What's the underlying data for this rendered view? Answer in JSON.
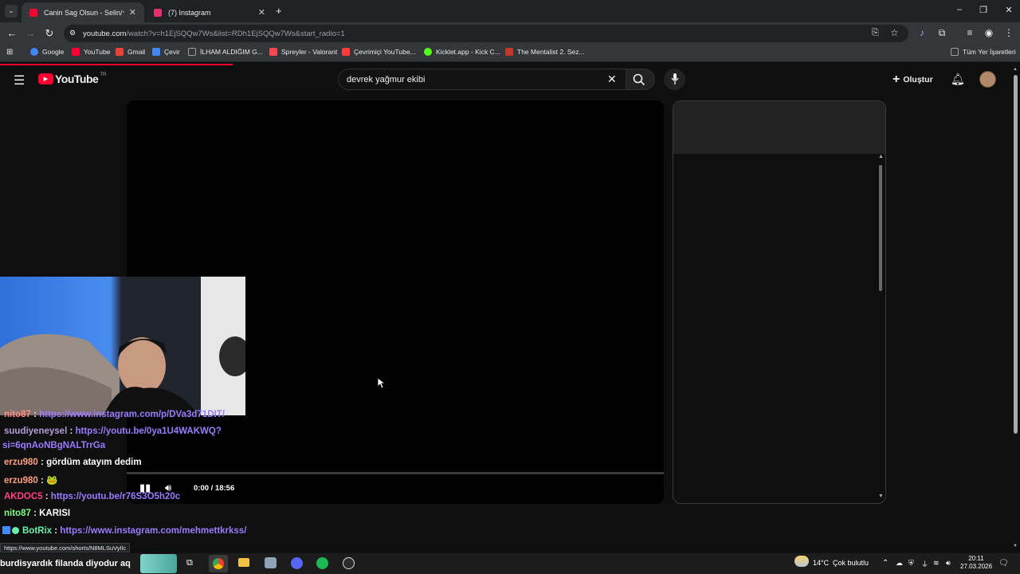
{
  "tabs": [
    {
      "title": "Canin Sag Olsun - Selin/セリン (",
      "active": true,
      "favicon_color": "#ff0033"
    },
    {
      "title": "(7) Instagram",
      "active": false,
      "favicon_color": "#e1306c"
    }
  ],
  "address": {
    "host": "youtube.com",
    "path": "/watch?v=h1EjSQQw7Ws&list=RDh1EjSQQw7Ws&start_radio=1"
  },
  "bookmarks": [
    {
      "label": "Google",
      "color": "#4285f4"
    },
    {
      "label": "YouTube",
      "color": "#ff0033"
    },
    {
      "label": "Gmail",
      "color": "#ea4335"
    },
    {
      "label": "Çevir",
      "color": "#4285f4"
    },
    {
      "label": "İLHAM ALDIĞIM G...",
      "color": "#9aa0a6"
    },
    {
      "label": "Spreyler - Valorant",
      "color": "#ff4655"
    },
    {
      "label": "Çevrimiçi YouTube...",
      "color": "#ff3b3b"
    },
    {
      "label": "Kicklet.app - Kick C...",
      "color": "#53fc18"
    },
    {
      "label": "The Mentalist 2. Sez...",
      "color": "#c0392b"
    }
  ],
  "bookmarks_all": "Tüm Yer İşaretleri",
  "youtube": {
    "logo": "YouTube",
    "region": "TR",
    "search_query": "devrek yağmur ekibi",
    "create_label": "Oluştur",
    "time_display": "0:00 / 18:56",
    "progress_fraction": 0.0
  },
  "chat": [
    {
      "user": "nito87",
      "color": "#ff8a80",
      "text": "https://www.instagram.com/p/DVa3d71DIT/",
      "is_link": true
    },
    {
      "user": "suudiyeneysel",
      "color": "#b39ddb",
      "text": "https://youtu.be/0ya1U4WAKWQ?",
      "is_link": true,
      "cont": "si=6qnAoNBgNALTrrGa"
    },
    {
      "user": "erzu980",
      "color": "#ff9e80",
      "text": "gördüm atayım dedim",
      "is_link": false
    },
    {
      "user": "erzu980",
      "color": "#ff9e80",
      "text": "🐸",
      "is_link": false
    },
    {
      "user": "AKDOC5",
      "color": "#ff4081",
      "text": "https://youtu.be/r76S3O5h20c",
      "is_link": true
    },
    {
      "user": "nito87",
      "color": "#80ff80",
      "text": "KARISI",
      "is_link": false
    },
    {
      "user": "BotRix",
      "color": "#69f0ae",
      "text": "https://www.instagram.com/mehmettkrkss/",
      "is_link": true
    }
  ],
  "status_url": "https://www.youtube.com/shorts/N8MLSuVyIlc",
  "ticker": "burdisyardık filanda diyodur aq",
  "taskbar": {
    "weather": "14°C",
    "weather_desc": "Çok bulutlu",
    "time": "20:11",
    "date": "27.03.2026"
  }
}
